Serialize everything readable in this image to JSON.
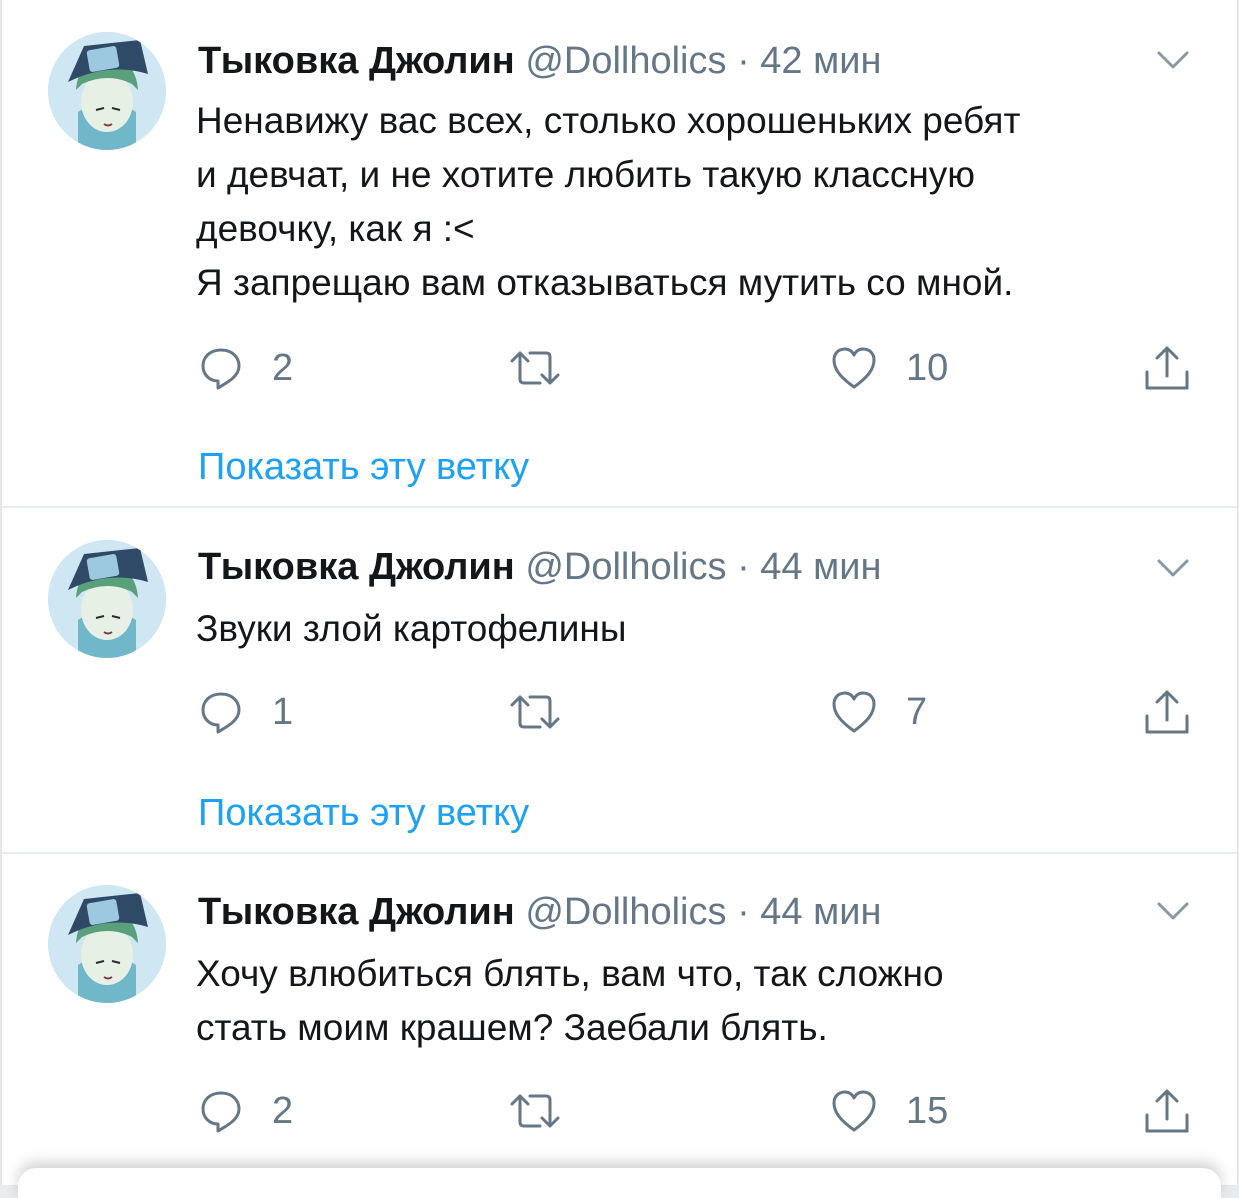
{
  "colors": {
    "name": "#14171a",
    "muted": "#657786",
    "link": "#1da1f2",
    "divider": "#e6ecf0"
  },
  "icons": {
    "reply": "reply-icon",
    "retweet": "retweet-icon",
    "like": "heart-icon",
    "share": "share-icon",
    "menu": "chevron-down-icon"
  },
  "tweets": [
    {
      "name": "Тыковка Джолин",
      "handle": "@Dollholics",
      "dot": "·",
      "time": "42 мин",
      "lines": [
        "Ненавижу вас всех, столько хорошеньких ребят",
        "и девчат, и не хотите любить такую классную",
        "девочку, как я :<",
        "Я запрещаю вам отказываться мутить со мной."
      ],
      "replies": "2",
      "retweets": "",
      "likes": "10",
      "thread_link": "Показать эту ветку"
    },
    {
      "name": "Тыковка Джолин",
      "handle": "@Dollholics",
      "dot": "·",
      "time": "44 мин",
      "lines": [
        "Звуки злой картофелины"
      ],
      "replies": "1",
      "retweets": "",
      "likes": "7",
      "thread_link": "Показать эту ветку"
    },
    {
      "name": "Тыковка Джолин",
      "handle": "@Dollholics",
      "dot": "·",
      "time": "44 мин",
      "lines": [
        "Хочу влюбиться блять, вам что, так сложно",
        "стать моим крашем?  Заебали блять."
      ],
      "replies": "2",
      "retweets": "",
      "likes": "15"
    }
  ]
}
